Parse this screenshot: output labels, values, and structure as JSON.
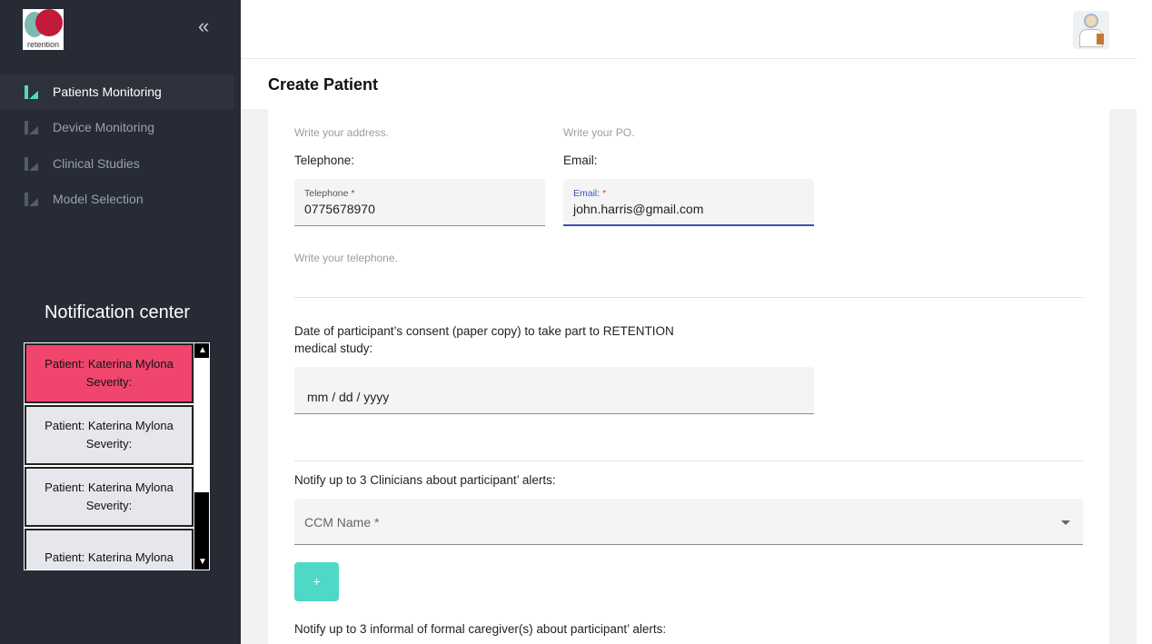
{
  "brand": {
    "logo_text": "retention"
  },
  "sidebar": {
    "items": [
      {
        "label": "Patients Monitoring",
        "active": true
      },
      {
        "label": "Device Monitoring",
        "active": false
      },
      {
        "label": "Clinical Studies",
        "active": false
      },
      {
        "label": "Model Selection",
        "active": false
      }
    ],
    "collapse_icon": "double-chevron-left-icon"
  },
  "notifications": {
    "title": "Notification center",
    "items": [
      {
        "patient": "Patient: Katerina Mylona",
        "severity": "Severity:",
        "color": "#f0466e"
      },
      {
        "patient": "Patient: Katerina Mylona",
        "severity": "Severity:",
        "color": "#e6e7ec"
      },
      {
        "patient": "Patient: Katerina Mylona",
        "severity": "Severity:",
        "color": "#e6e7ec"
      },
      {
        "patient": "Patient: Katerina Mylona",
        "severity": "",
        "color": "#e6e7ec"
      }
    ]
  },
  "header": {
    "avatar_icon": "doctor-avatar-icon"
  },
  "page": {
    "title": "Create Patient"
  },
  "form": {
    "address_hint": "Write your address.",
    "po_hint": "Write your PO.",
    "telephone_label": "Telephone:",
    "email_label": "Email:",
    "telephone_field_label": "Telephone *",
    "telephone_value": "0775678970",
    "email_field_label": "Email:",
    "email_required_mark": "*",
    "email_value": "john.harris@gmail.com",
    "telephone_hint": "Write your telephone.",
    "consent_label_line1": "Date of participant’s consent (paper copy) to take part to RETENTION",
    "consent_label_line2": "medical study:",
    "date_placeholder": "mm / dd / yyyy",
    "clinicians_label": "Notify up to 3 Clinicians about participant’ alerts:",
    "ccm_placeholder": "CCM Name *",
    "add_button": "+",
    "caregivers_label": "Notify up to 3 informal of formal caregiver(s) about participant’ alerts:"
  },
  "colors": {
    "sidebar_bg": "#262b36",
    "accent": "#4ed8c6",
    "alert": "#f0466e",
    "focus": "#3f51b5"
  }
}
